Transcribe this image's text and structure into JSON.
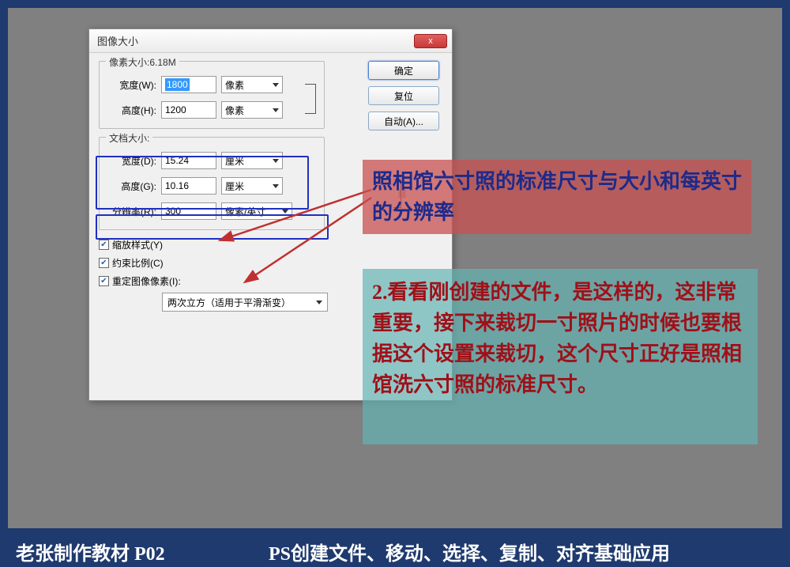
{
  "dialog": {
    "title": "图像大小",
    "close_label": "x",
    "ok_label": "确定",
    "reset_label": "复位",
    "auto_label": "自动(A)...",
    "pixel_dim": {
      "legend": "像素大小:6.18M",
      "width_label": "宽度(W):",
      "width_value": "1800",
      "width_unit": "像素",
      "height_label": "高度(H):",
      "height_value": "1200",
      "height_unit": "像素"
    },
    "doc_size": {
      "legend": "文档大小:",
      "width_label": "宽度(D):",
      "width_value": "15.24",
      "width_unit": "厘米",
      "height_label": "高度(G):",
      "height_value": "10.16",
      "height_unit": "厘米",
      "res_label": "分辨率(R):",
      "res_value": "300",
      "res_unit": "像素/英寸"
    },
    "scale_styles_label": "缩放样式(Y)",
    "constrain_label": "约束比例(C)",
    "resample_label": "重定图像像素(I):",
    "interp_method": "两次立方（适用于平滑渐变）"
  },
  "annotations": {
    "red_text": "照相馆六寸照的标准尺寸与大小和每英寸的分辨率",
    "cyan_text": "2.看看刚创建的文件，是这样的，这非常重要，接下来裁切一寸照片的时候也要根据这个设置来裁切，这个尺寸正好是照相馆洗六寸照的标准尺寸。"
  },
  "footer": {
    "left": "老张制作教材  P02",
    "right": "PS创建文件、移动、选择、复制、对齐基础应用"
  }
}
